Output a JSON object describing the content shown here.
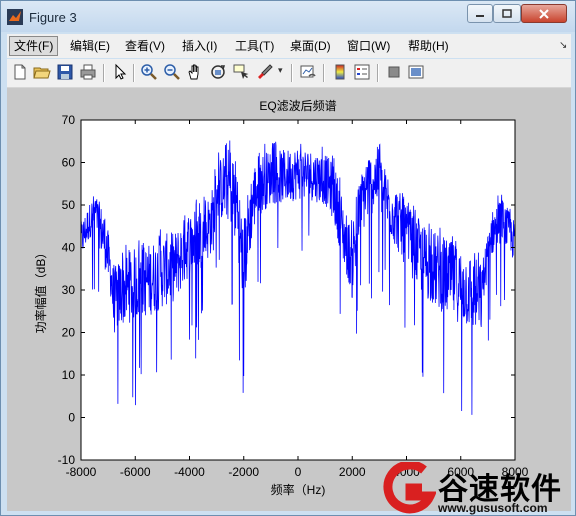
{
  "window": {
    "title": "Figure 3"
  },
  "menu": {
    "items": [
      "文件(F)",
      "编辑(E)",
      "查看(V)",
      "插入(I)",
      "工具(T)",
      "桌面(D)",
      "窗口(W)",
      "帮助(H)"
    ]
  },
  "toolbar": {
    "icons": [
      "new-figure-icon",
      "open-file-icon",
      "save-icon",
      "print-icon",
      "pointer-icon",
      "zoom-in-icon",
      "zoom-out-icon",
      "pan-icon",
      "rotate-3d-icon",
      "data-cursor-icon",
      "brush-icon",
      "link-plot-icon",
      "colorbar-icon",
      "legend-icon",
      "hide-plot-tools-icon",
      "show-plot-tools-icon"
    ]
  },
  "chart_data": {
    "type": "line",
    "title": "EQ滤波后频谱",
    "xlabel": "频率（Hz)",
    "ylabel": "功率幅值（dB）",
    "xlim": [
      -8000,
      8000
    ],
    "ylim": [
      -10,
      70
    ],
    "xticks": [
      "-8000",
      "-6000",
      "-4000",
      "-2000",
      "0",
      "2000",
      "4000",
      "6000",
      "8000"
    ],
    "yticks": [
      "-10",
      "0",
      "10",
      "20",
      "30",
      "40",
      "50",
      "60",
      "70"
    ],
    "grid": false,
    "series": [
      {
        "color": "#0000ff",
        "envelope": {
          "x": [
            -8000,
            -7500,
            -7100,
            -6900,
            -6800,
            -6500,
            -6000,
            -5500,
            -5000,
            -4500,
            -4000,
            -3500,
            -3100,
            -3000,
            -2500,
            -2200,
            -2100,
            -2000,
            -1900,
            -1700,
            -1500,
            -1000,
            -500,
            0,
            500,
            1000,
            1300,
            1500,
            1700,
            1900,
            2000,
            2100,
            2200,
            2500,
            3000,
            3100,
            3500,
            4000,
            4500,
            5000,
            5500,
            6000,
            6500,
            6800,
            6900,
            7100,
            7500,
            8000
          ],
          "upper": [
            46,
            53,
            48,
            40,
            35,
            38,
            40,
            41,
            43,
            44,
            49,
            50,
            55,
            60,
            64,
            60,
            50,
            45,
            52,
            58,
            62,
            63,
            63,
            64,
            63,
            62,
            60,
            56,
            50,
            46,
            44,
            48,
            54,
            62,
            64,
            60,
            56,
            50,
            46,
            44,
            42,
            40,
            38,
            36,
            40,
            48,
            52,
            46
          ],
          "lower": [
            34,
            42,
            30,
            24,
            14,
            16,
            17,
            18,
            20,
            22,
            28,
            30,
            34,
            42,
            40,
            30,
            24,
            20,
            24,
            36,
            42,
            46,
            46,
            47,
            47,
            46,
            42,
            36,
            30,
            26,
            22,
            26,
            34,
            40,
            46,
            42,
            36,
            30,
            24,
            20,
            18,
            16,
            14,
            14,
            26,
            34,
            38,
            33
          ]
        }
      }
    ]
  },
  "watermark": {
    "brand": "谷速软件",
    "url": "www.gususoft.com"
  }
}
